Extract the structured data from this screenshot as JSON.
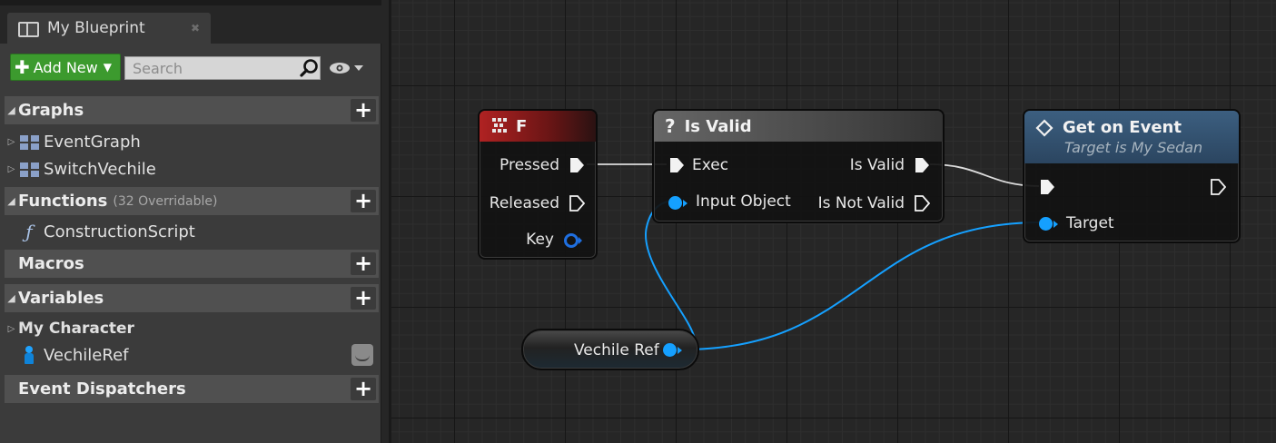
{
  "tab": {
    "title": "My Blueprint",
    "close": "✖"
  },
  "toolbar": {
    "add_new": "Add New",
    "search_placeholder": "Search"
  },
  "sidebar": {
    "graphs": {
      "label": "Graphs",
      "items": [
        "EventGraph",
        "SwitchVechile"
      ]
    },
    "functions": {
      "label": "Functions",
      "count": "(32 Overridable)",
      "items": [
        "ConstructionScript"
      ]
    },
    "macros": {
      "label": "Macros"
    },
    "variables": {
      "label": "Variables",
      "subcategory": "My Character",
      "items": [
        "VechileRef"
      ]
    },
    "event_dispatchers": {
      "label": "Event Dispatchers"
    }
  },
  "nodes": {
    "key_f": {
      "title": "F",
      "pins": [
        "Pressed",
        "Released",
        "Key"
      ]
    },
    "is_valid": {
      "title": "Is Valid",
      "inputs": [
        "Exec",
        "Input Object"
      ],
      "outputs": [
        "Is Valid",
        "Is Not Valid"
      ]
    },
    "get_on_event": {
      "title": "Get on Event",
      "subtitle": "Target is My Sedan",
      "inputs": [
        "Target"
      ]
    },
    "vechile_ref": {
      "title": "Vechile Ref"
    }
  },
  "colors": {
    "add_new": "#3c9a2e",
    "object_pin": "#15a0ff",
    "event_header": "#b02222",
    "function_header": "#3c5f80",
    "macro_header": "#666666"
  }
}
